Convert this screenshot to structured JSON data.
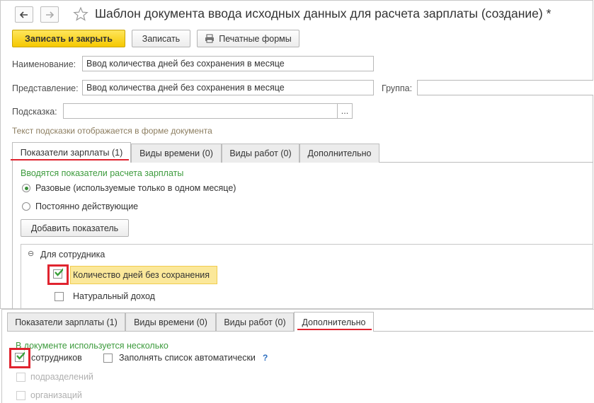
{
  "window": {
    "title": "Шаблон документа ввода исходных данных для расчета зарплаты (создание) *"
  },
  "toolbar": {
    "save_close": "Записать и закрыть",
    "save": "Записать",
    "print_forms": "Печатные формы"
  },
  "form": {
    "name_label": "Наименование:",
    "name_value": "Ввод количества дней без сохранения в месяце",
    "repr_label": "Представление:",
    "repr_value": "Ввод количества дней без сохранения в месяце",
    "group_label": "Группа:",
    "group_value": "",
    "hint_label": "Подсказка:",
    "hint_value": "",
    "hint_button": "...",
    "hint_note": "Текст подсказки отображается в форме документа"
  },
  "tabs": [
    {
      "label": "Показатели зарплаты (1)"
    },
    {
      "label": "Виды времени (0)"
    },
    {
      "label": "Виды работ (0)"
    },
    {
      "label": "Дополнительно"
    }
  ],
  "indicators": {
    "heading": "Вводятся показатели расчета зарплаты",
    "radio_once": "Разовые (используемые только в одном месяце)",
    "radio_permanent": "Постоянно действующие",
    "add_button": "Добавить показатель",
    "tree_group": "Для сотрудника",
    "tree_items": [
      {
        "label": "Количество дней без сохранения",
        "checked": true
      },
      {
        "label": "Натуральный доход",
        "checked": false
      }
    ]
  },
  "additional": {
    "heading": "В документе используется несколько",
    "employees": "сотрудников",
    "autofill": "Заполнять список автоматически",
    "help": "?",
    "departments": "подразделений",
    "organizations": "организаций"
  },
  "colors": {
    "accent_yellow": "#f5c800",
    "highlight_red": "#e0242f",
    "green_text": "#3d9b3d",
    "check_green": "#3aa03a"
  }
}
